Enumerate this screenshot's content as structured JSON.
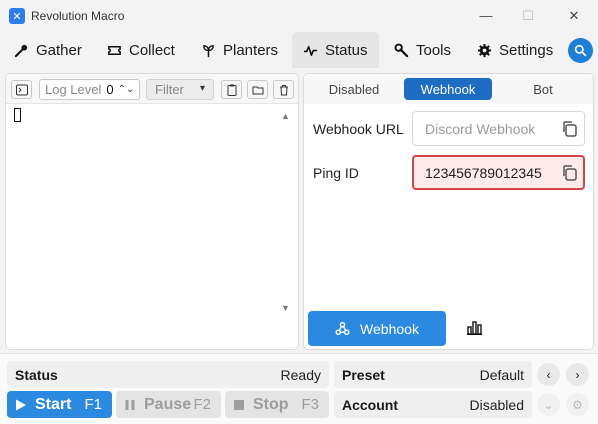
{
  "window": {
    "title": "Revolution Macro",
    "minimize_glyph": "—",
    "maximize_glyph": "☐",
    "close_glyph": "✕"
  },
  "nav": {
    "tabs": [
      {
        "label": "Gather",
        "icon": "gather-icon"
      },
      {
        "label": "Collect",
        "icon": "ticket-icon"
      },
      {
        "label": "Planters",
        "icon": "planter-icon"
      },
      {
        "label": "Status",
        "icon": "activity-icon",
        "active": true
      },
      {
        "label": "Tools",
        "icon": "wrench-icon"
      },
      {
        "label": "Settings",
        "icon": "gear-icon"
      }
    ],
    "search_icon": "search-icon"
  },
  "log_panel": {
    "log_level_placeholder": "Log Level",
    "log_level_value": "0",
    "filter_placeholder": "Filter"
  },
  "status_panel": {
    "subtabs": [
      {
        "label": "Disabled"
      },
      {
        "label": "Webhook",
        "active": true
      },
      {
        "label": "Bot"
      }
    ],
    "webhook_url_label": "Webhook URL",
    "webhook_url_placeholder": "Discord Webhook",
    "ping_id_label": "Ping ID",
    "ping_id_value": "123456789012345",
    "webhook_button": "Webhook"
  },
  "bottom": {
    "status_label": "Status",
    "status_value": "Ready",
    "preset_label": "Preset",
    "preset_value": "Default",
    "account_label": "Account",
    "account_value": "Disabled",
    "start_label": "Start",
    "start_key": "F1",
    "pause_label": "Pause",
    "pause_key": "F2",
    "stop_label": "Stop",
    "stop_key": "F3"
  },
  "colors": {
    "accent": "#2b8ae0",
    "accent_dark": "#1f6cc3",
    "error_border": "#d34545",
    "error_bg": "#fdebeb"
  }
}
